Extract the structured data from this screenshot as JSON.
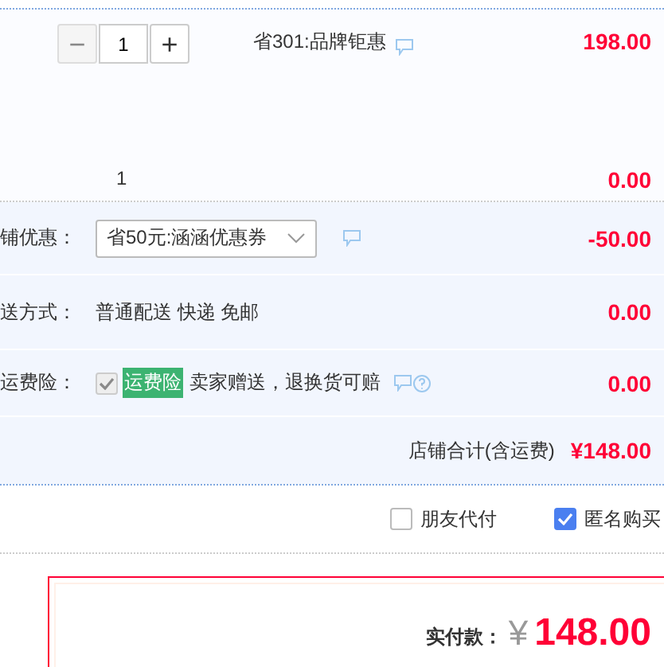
{
  "item": {
    "quantity": "1",
    "minus": "−",
    "plus": "+",
    "promo": "省301:品牌钜惠",
    "price": "198.00",
    "extra_qty": "1",
    "extra_price": "0.00"
  },
  "rows": [
    {
      "kind": "select",
      "label": "铺优惠：",
      "value": "省50元:涵涵优惠券",
      "amount": "-50.00"
    },
    {
      "kind": "text",
      "label": "送方式：",
      "value": "普通配送 快递 免邮",
      "amount": "0.00"
    },
    {
      "kind": "insurance",
      "label": "运费险：",
      "checked": true,
      "disabled": true,
      "tag": "运费险",
      "value": "卖家赠送，退换货可赔",
      "amount": "0.00"
    }
  ],
  "store_total": {
    "label": "店铺合计(含运费)",
    "amount": "¥148.00"
  },
  "options": [
    {
      "label": "朋友代付",
      "checked": false
    },
    {
      "label": "匿名购买",
      "checked": true
    }
  ],
  "payment": {
    "label": "实付款：",
    "currency": "¥",
    "amount": "148.00"
  }
}
